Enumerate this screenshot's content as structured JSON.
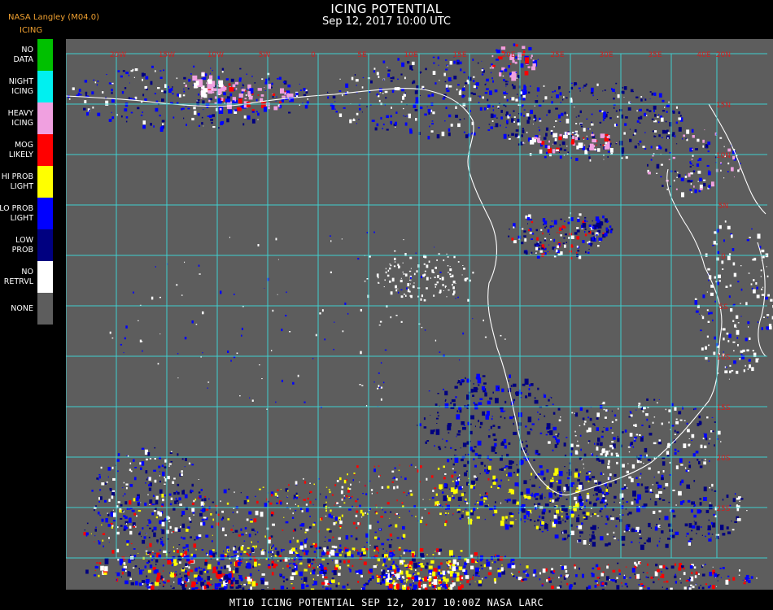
{
  "title": "ICING POTENTIAL",
  "subtitle": "Sep 12, 2017 10:00 UTC",
  "producer": "NASA Langley (M04.0)",
  "product": "ICING",
  "legend": [
    {
      "label": [
        "NO",
        "DATA"
      ],
      "color": "#00c000"
    },
    {
      "label": [
        "NIGHT",
        "ICING"
      ],
      "color": "#00f0f0"
    },
    {
      "label": [
        "HEAVY",
        "ICING"
      ],
      "color": "#f0a0e0"
    },
    {
      "label": [
        "MOG",
        "LIKELY"
      ],
      "color": "#ff0000"
    },
    {
      "label": [
        "HI PROB",
        "LIGHT"
      ],
      "color": "#ffff00"
    },
    {
      "label": [
        "LO PROB",
        "LIGHT"
      ],
      "color": "#0000ff"
    },
    {
      "label": [
        "LOW",
        "PROB"
      ],
      "color": "#000080"
    },
    {
      "label": [
        "NO",
        "RETRVL"
      ],
      "color": "#ffffff"
    },
    {
      "label": [
        "NONE"
      ],
      "color": "#5d5d5d"
    }
  ],
  "grid_color": "#40d0d0",
  "coastline_color": "#ffffff",
  "lon_labels": [
    "20W",
    "15W",
    "10W",
    "5W",
    "0",
    "5E",
    "10E",
    "15E",
    "20E",
    "25E",
    "30E",
    "35E",
    "40E"
  ],
  "lat_labels": [
    "20N",
    "15N",
    "10N",
    "5N",
    "0",
    "5S",
    "10S",
    "15S",
    "20S",
    "25S",
    "30S"
  ],
  "footer": "MT10   ICING POTENTIAL   SEP 12, 2017 10:00Z   NASA LARC"
}
